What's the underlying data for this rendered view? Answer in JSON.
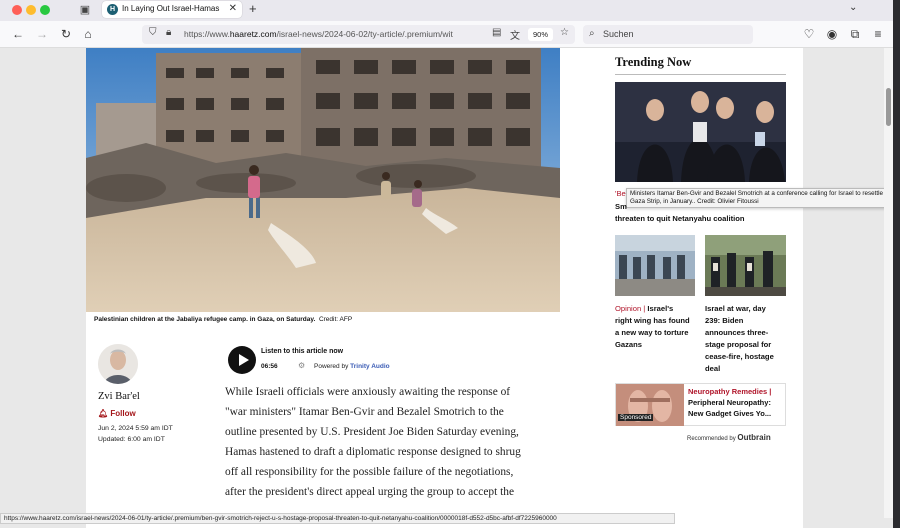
{
  "browser": {
    "tab_title": "In Laying Out Israel-Hamas Dea",
    "url_prefix": "https://www.",
    "url_host": "haaretz.com",
    "url_rest": "/israel-news/2024-06-02/ty-article/.premium/wit",
    "zoom": "90%",
    "search_placeholder": "Suchen"
  },
  "article": {
    "photo_caption": "Palestinian children at the Jabaliya refugee camp. in Gaza, on Saturday.",
    "photo_credit": "Credit: AFP",
    "author_name": "Zvi Bar'el",
    "follow_label": "Follow",
    "published": "Jun 2, 2024 5:59 am IDT",
    "updated": "Updated: 6:00 am IDT",
    "audio_label": "Listen to this article now",
    "audio_time": "06:56",
    "audio_powered_prefix": "Powered by",
    "audio_powered_brand": "Trinity Audio",
    "body_lines": [
      "While Israeli officials were anxiously awaiting the response of",
      "\"war ministers\" Itamar Ben-Gvir and Bezalel Smotrich to the",
      "outline presented by U.S. President Joe Biden Saturday evening,",
      "Hamas hastened to draft a diplomatic response designed to shrug",
      "off all responsibility for the possible failure of the negotiations,",
      "after the president's direct appeal urging the group to accept the"
    ]
  },
  "sidebar": {
    "title": "Trending Now",
    "tooltip": "Ministers Itamar Ben-Gvir and Bezalel Smotrich at a conference calling for Israel to resettle the Gaza Strip, in January.. Credit: Olivier Fitoussi",
    "item1_line1": "'Be",
    "item1_line2": "Sm",
    "item1_line3": "threaten to quit Netanyahu coalition",
    "item2_kicker": "Opinion",
    "item2_sep": " | ",
    "item2_lines": [
      "Israel's",
      "right wing has found",
      "a new way to torture",
      "Gazans"
    ],
    "item3_lines": [
      "Israel at war, day",
      "239: Biden",
      "announces three-",
      "stage proposal for",
      "cease-fire, hostage",
      "deal"
    ],
    "ad_kicker": "Neuropathy Remedies |",
    "ad_title": "Peripheral Neuropathy: New Gadget Gives Yo...",
    "sponsored_label": "Sponsored",
    "recommended_label": "Recommended by",
    "outbrain_label": "Outbrain"
  },
  "status_url": "https://www.haaretz.com/israel-news/2024-06-01/ty-article/.premium/ben-gvir-smotrich-reject-u-s-hostage-proposal-threaten-to-quit-netanyahu-coalition/0000018f-d552-d5bc-afbf-df7225960000"
}
